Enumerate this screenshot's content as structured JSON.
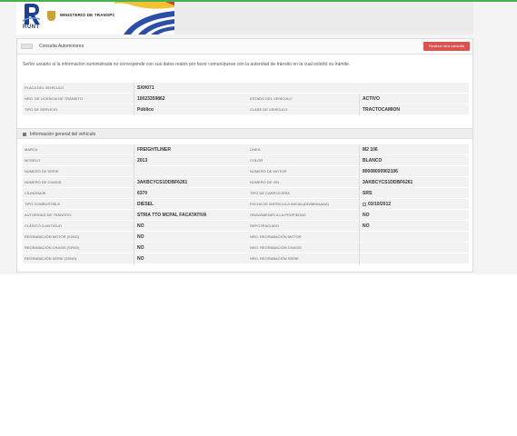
{
  "header": {
    "runt_label": "RUNT",
    "ministry_label": "MINISTERIO DE TRANSPORTE"
  },
  "toolbar": {
    "title": "Consulta Automotores",
    "new_query_label": "Realizar otra consulta"
  },
  "notice": "Señor usuario si la información suministrada no corresponde con sus datos reales por favor comuníquese con la autoridad de tránsito en la cual solicitó su trámite.",
  "summary": {
    "rows": [
      {
        "l1": "PLACA DEL VEHÍCULO",
        "v1": "SXH071",
        "l2": "",
        "v2": ""
      },
      {
        "l1": "NRO. DE LICENCIA DE TRÁNSITO",
        "v1": "10023359862",
        "l2": "ESTADO DEL VEHÍCULO",
        "v2": "ACTIVO"
      },
      {
        "l1": "TIPO DE SERVICIO",
        "v1": "Público",
        "l2": "CLASE DE VEHÍCULO",
        "v2": "TRACTOCAMION"
      }
    ]
  },
  "general": {
    "title": "Información general del vehículo",
    "rows": [
      {
        "l1": "MARCA",
        "v1": "FREIGHTLINER",
        "l2": "LÍNEA",
        "v2": "M2 106"
      },
      {
        "l1": "MODELO",
        "v1": "2013",
        "l2": "COLOR",
        "v2": "BLANCO"
      },
      {
        "l1": "NÚMERO DE SERIE",
        "v1": "",
        "l2": "NÚMERO DE MOTOR",
        "v2": "80008000902106"
      },
      {
        "l1": "NÚMERO DE CHASIS",
        "v1": "3AKBCYCS1DDBF6261",
        "l2": "NÚMERO DE VIN",
        "v2": "3AKBCYCS1DDBF6261"
      },
      {
        "l1": "CILINDRAJE",
        "v1": "6370",
        "l2": "TIPO DE CARROCERÍA",
        "v2": "SRS"
      },
      {
        "l1": "TIPO COMBUSTIBLE",
        "v1": "DIESEL",
        "l2": "FECHA DE MATRICULA INICIAL(DD/MM/AAAA)",
        "v2": "03/10/2012"
      },
      {
        "l1": "AUTORIDAD DE TRÁNSITO",
        "v1": "STRIA TTO MCPAL FACATATIVA",
        "l2": "GRAVÁMENES A LA PROPIEDAD",
        "v2": "NO"
      },
      {
        "l1": "CLÁSICO O ANTIGUO",
        "v1": "NO",
        "l2": "REPOTENCIADO",
        "v2": "NO"
      },
      {
        "l1": "REGRABACIÓN MOTOR (SI/NO)",
        "v1": "NO",
        "l2": "NRO. REGRABACIÓN MOTOR",
        "v2": ""
      },
      {
        "l1": "REGRABACIÓN CHASIS (SI/NO)",
        "v1": "NO",
        "l2": "NRO. REGRABACIÓN CHASIS",
        "v2": ""
      },
      {
        "l1": "REGRABACIÓN SERIE (SI/NO)",
        "v1": "NO",
        "l2": "NRO. REGRABACIÓN SERIE",
        "v2": ""
      }
    ]
  },
  "colors": {
    "accent_green": "#4caf50",
    "button_red": "#d9534f",
    "runt_blue": "#1f3f8f"
  }
}
